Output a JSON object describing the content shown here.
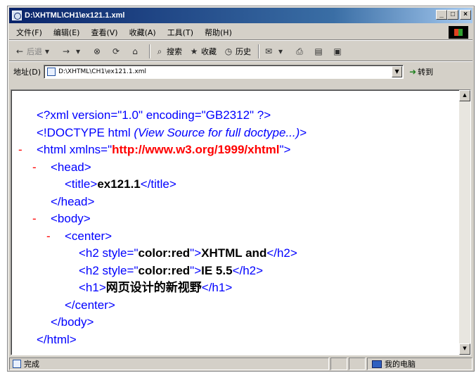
{
  "window": {
    "title": "D:\\XHTML\\CH1\\ex121.1.xml",
    "buttons": {
      "minimize": "_",
      "maximize": "□",
      "close": "×"
    }
  },
  "menu": {
    "items": [
      {
        "label": "文件(F)"
      },
      {
        "label": "编辑(E)"
      },
      {
        "label": "查看(V)"
      },
      {
        "label": "收藏(A)"
      },
      {
        "label": "工具(T)"
      },
      {
        "label": "帮助(H)"
      }
    ]
  },
  "toolbar": {
    "back": "后退",
    "search": "搜索",
    "favorites": "收藏",
    "history": "历史"
  },
  "address": {
    "label": "地址(D)",
    "value": "D:\\XHTML\\CH1\\ex121.1.xml",
    "go": "转到"
  },
  "code": {
    "l1": "<?xml version=\"1.0\" encoding=\"GB2312\" ?>",
    "l2a": "<!DOCTYPE html ",
    "l2b": "(View Source for full doctype...)",
    "l2c": ">",
    "l3a": "<html xmlns=\"",
    "l3b": "http://www.w3.org/1999/xhtml",
    "l3c": "\">",
    "l4": "<head>",
    "l5a": "<title>",
    "l5b": "ex121.1",
    "l5c": "</title>",
    "l6": "</head>",
    "l7": "<body>",
    "l8": "<center>",
    "l9a": "<h2 style=\"",
    "l9b": "color:red",
    "l9c": "\">",
    "l9d": "XHTML and",
    "l9e": "</h2>",
    "l10a": "<h2 style=\"",
    "l10b": "color:red",
    "l10c": "\">",
    "l10d": "IE 5.5",
    "l10e": "</h2>",
    "l11a": "<h1>",
    "l11b": "网页设计的新视野",
    "l11c": "</h1>",
    "l12": "</center>",
    "l13": "</body>",
    "l14": "</html>"
  },
  "status": {
    "text": "完成",
    "zone": "我的电脑"
  }
}
